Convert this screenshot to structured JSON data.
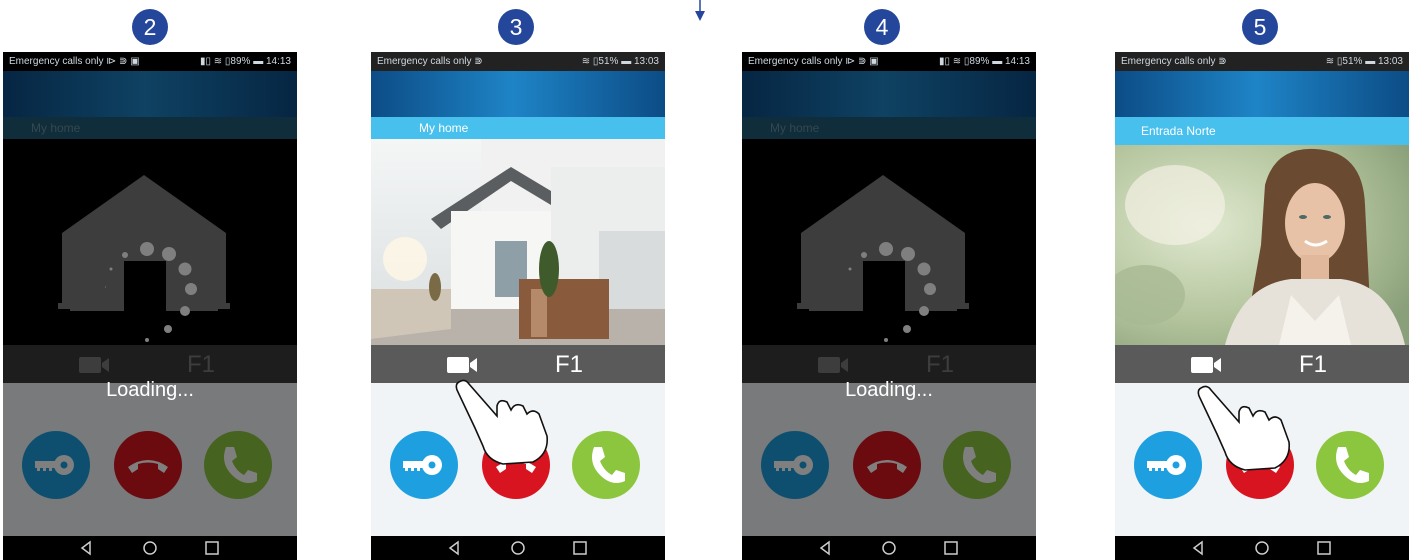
{
  "steps": [
    {
      "number": "2",
      "state": "loading",
      "status_left": "Emergency calls only ⧐ ⋑ ▣",
      "status_right": "▮▯ ≋ ▯89% ▬ 14:13",
      "title": "My home",
      "f1_label": "F1",
      "loading_text": "Loading..."
    },
    {
      "number": "3",
      "state": "video-house",
      "status_left": "Emergency calls only ⋑",
      "status_right": "≋ ▯51% ▬ 13:03",
      "title": "My home",
      "f1_label": "F1",
      "loading_text": ""
    },
    {
      "number": "4",
      "state": "loading",
      "status_left": "Emergency calls only ⧐ ⋑ ▣",
      "status_right": "▮▯ ≋ ▯89% ▬ 14:13",
      "title": "My home",
      "f1_label": "F1",
      "loading_text": "Loading..."
    },
    {
      "number": "5",
      "state": "video-person",
      "status_left": "Emergency calls only ⋑",
      "status_right": "≋ ▯51% ▬ 13:03",
      "title": "Entrada Norte",
      "f1_label": "F1",
      "loading_text": ""
    }
  ],
  "colors": {
    "badge": "#25479b",
    "unlock": "#1d9fe0",
    "hangup": "#d7141f",
    "answer": "#8cc63f",
    "title_bar_active": "#48c0ee",
    "title_bar_inactive": "#1f5b75"
  }
}
